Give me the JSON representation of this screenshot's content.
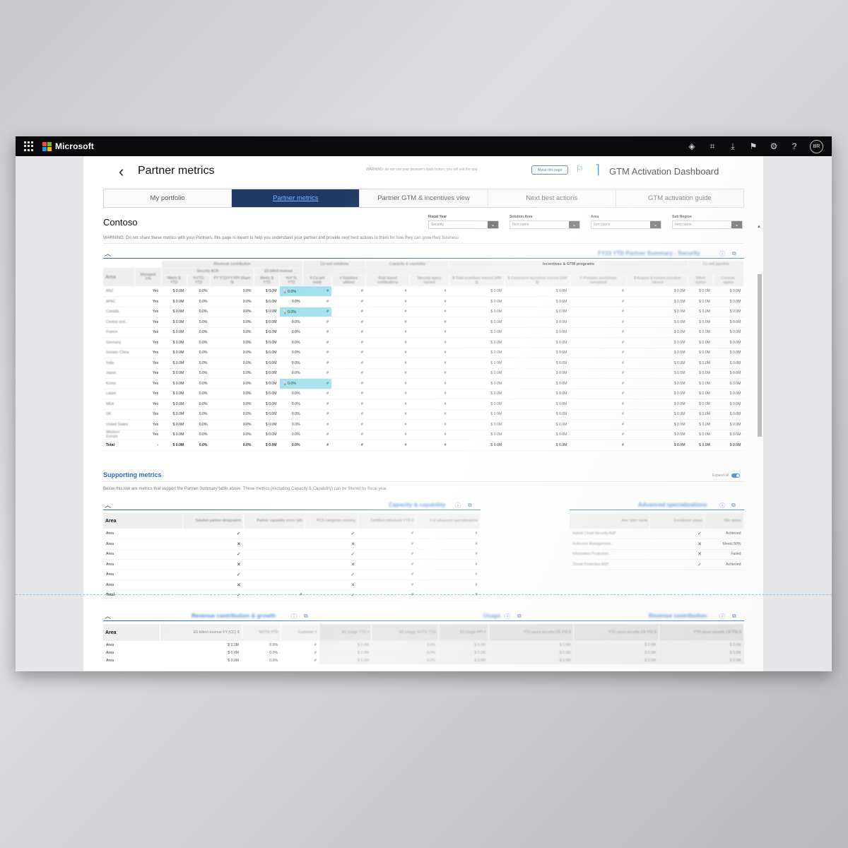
{
  "topbar": {
    "brand": "Microsoft",
    "avatar_initials": "BR",
    "icons": [
      "apps-waffle-icon",
      "teams-icon",
      "focus-icon",
      "download-icon",
      "flag-icon",
      "settings-gear-icon",
      "help-icon"
    ]
  },
  "header": {
    "back_glyph": "‹",
    "title": "Partner metrics",
    "warning": "WARNING: do not use your browser's back button, you will exit the app",
    "about_label": "About this page",
    "dashboard_title": "GTM Activation Dashboard"
  },
  "tabs": [
    {
      "label": "My portfolio",
      "active": false
    },
    {
      "label": "Partner metrics",
      "active": true
    },
    {
      "label": "Partner GTM & incentives view",
      "active": false
    },
    {
      "label": "Next best actions",
      "active": false
    },
    {
      "label": "GTM activation guide",
      "active": false
    }
  ],
  "company": "Contoso",
  "filters": [
    {
      "label": "Fiscal Year",
      "value": "Security"
    },
    {
      "label": "Solution Area",
      "value": "Item name"
    },
    {
      "label": "Area",
      "value": "Item name"
    },
    {
      "label": "Sub Region",
      "value": "Item name"
    }
  ],
  "warning_text": "WARNING: Do not share these metrics with your Partners, this page is meant to help you understand your partner and provide next best actions to them for how they can grow their business",
  "summary": {
    "title": "FY23 YTD Partner Summary - Security",
    "groups": {
      "revenue": "Revenue contribution",
      "cosell": "Co-sell solutions",
      "capacity": "Capacity & capability",
      "incentives": "Incentives & GTM programs",
      "pipeline": "Co-sell pipeline"
    },
    "subgroups": {
      "acr": "Security ACR",
      "e5": "E5 billed revenue"
    },
    "columns": [
      "Area",
      "Managed Y/N",
      "Metric $ YTD",
      "%YTG YTD",
      "FY YTD/YY PPI Share %",
      "Metric $ YTD",
      "YoY % YTD",
      "# Co-sell ready",
      "# Solutions utilized",
      "Role based certifications",
      "Security specs earned",
      "$ Total incentives earned (MM $)",
      "$ Commerce incentives earned (MM $)",
      "# PreSales workshops completed",
      "$ Acquire & nurture incentive earned",
      "Billed opptys",
      "Consum. opptys"
    ],
    "rows": [
      {
        "area": "ANZ",
        "managed": "Yes",
        "hl": true
      },
      {
        "area": "APAC",
        "managed": "Yes",
        "hl": false
      },
      {
        "area": "Canada",
        "managed": "Yes",
        "hl": true
      },
      {
        "area": "Central and...",
        "managed": "Yes",
        "hl": false
      },
      {
        "area": "France",
        "managed": "Yes",
        "hl": false
      },
      {
        "area": "Germany",
        "managed": "Yes",
        "hl": false
      },
      {
        "area": "Greater China",
        "managed": "Yes",
        "hl": false
      },
      {
        "area": "India",
        "managed": "Yes",
        "hl": false
      },
      {
        "area": "Japan",
        "managed": "Yes",
        "hl": false
      },
      {
        "area": "Korea",
        "managed": "Yes",
        "hl": true
      },
      {
        "area": "Latam",
        "managed": "Yes",
        "hl": false
      },
      {
        "area": "MEA",
        "managed": "Yes",
        "hl": false
      },
      {
        "area": "UK",
        "managed": "Yes",
        "hl": false
      },
      {
        "area": "United States",
        "managed": "Yes",
        "hl": false
      },
      {
        "area": "Western Europe",
        "managed": "Yes",
        "hl": false
      }
    ],
    "total_label": "Total",
    "total_managed": "-",
    "money": "$ 0.0M",
    "pct": "0.0%",
    "hash": "#"
  },
  "supporting": {
    "title": "Supporting metrics",
    "expand_label": "Expand all",
    "text": "Below this line are metrics that support the Partner Summary table above. These metrics (excluding Capacity & Capability) can be filtered by fiscal year."
  },
  "capability": {
    "title": "Capacity & capability",
    "columns": [
      "Area",
      "Solution partner designation",
      "Partner capability score (all)",
      "PCS categories missing",
      "Certified individuals YTD #",
      "# of advanced specializations"
    ],
    "rows": [
      {
        "area": "Area",
        "designation": "✓",
        "missing": "✓",
        "cert": "#",
        "adv": "#"
      },
      {
        "area": "Area",
        "designation": "✕",
        "missing": "✕",
        "cert": "#",
        "adv": "#"
      },
      {
        "area": "Area",
        "designation": "✓",
        "missing": "✓",
        "cert": "#",
        "adv": "#"
      },
      {
        "area": "Area",
        "designation": "✕",
        "missing": "✕",
        "cert": "#",
        "adv": "#"
      },
      {
        "area": "Area",
        "designation": "✓",
        "missing": "✓",
        "cert": "#",
        "adv": "#"
      },
      {
        "area": "Area",
        "designation": "✕",
        "missing": "✕",
        "cert": "#",
        "adv": "#"
      }
    ],
    "total": {
      "area": "Total",
      "designation": "✓",
      "score": "#",
      "missing": "✓",
      "cert": "#",
      "adv": "#"
    }
  },
  "advanced": {
    "title": "Advanced specializations",
    "columns": [
      "Adv. spec name",
      "Enrollment status",
      "Nbc status"
    ],
    "rows": [
      {
        "name": "Hybrid Cloud Security ASP",
        "enroll": "✓",
        "status": "Achieved"
      },
      {
        "name": "Id Access Management...",
        "enroll": "✕",
        "status": "Meets 50%"
      },
      {
        "name": "Information Protection...",
        "enroll": "✕",
        "status": "Failed"
      },
      {
        "name": "Threat Protection ASP",
        "enroll": "✓",
        "status": "Achieved"
      }
    ]
  },
  "revenue": {
    "title": "Revenue contribution & growth",
    "usage_title": "Usage",
    "contrib_title": "Revenue contribution",
    "columns": [
      "Area",
      "E5 billed revenue FY (CC) $",
      "%YTG YTD",
      "Customer #",
      "E5 Usage YTD #",
      "E5 Usage %YTG YTD",
      "E5 Usage PPI #",
      "YTD azure security CR PIN $",
      "YTD azure security CR PIN $",
      "YTD azure security CR PIN $"
    ],
    "rows": [
      {
        "area": "Area",
        "billed": "$ 0.0M",
        "pct": "0.0%",
        "cust": "#",
        "u1": "$ 0.0M",
        "u2": "0.0%",
        "u3": "$ 0.0M",
        "a1": "$ 0.0M",
        "a2": "$ 0.0M",
        "a3": "$ 0.0M"
      },
      {
        "area": "Area",
        "billed": "$ 0.0M",
        "pct": "0.0%",
        "cust": "#",
        "u1": "$ 0.0M",
        "u2": "0.0%",
        "u3": "$ 0.0M",
        "a1": "$ 0.0M",
        "a2": "$ 0.0M",
        "a3": "$ 0.0M"
      },
      {
        "area": "Area",
        "billed": "$ 0.0M",
        "pct": "0.0%",
        "cust": "#",
        "u1": "$ 0.0M",
        "u2": "0.0%",
        "u3": "$ 0.0M",
        "a1": "$ 0.0M",
        "a2": "$ 0.0M",
        "a3": "$ 0.0M"
      }
    ]
  },
  "colors": {
    "nav_active": "#1f3864",
    "accent": "#2b6cc4",
    "highlight": "#9fe1ec"
  }
}
